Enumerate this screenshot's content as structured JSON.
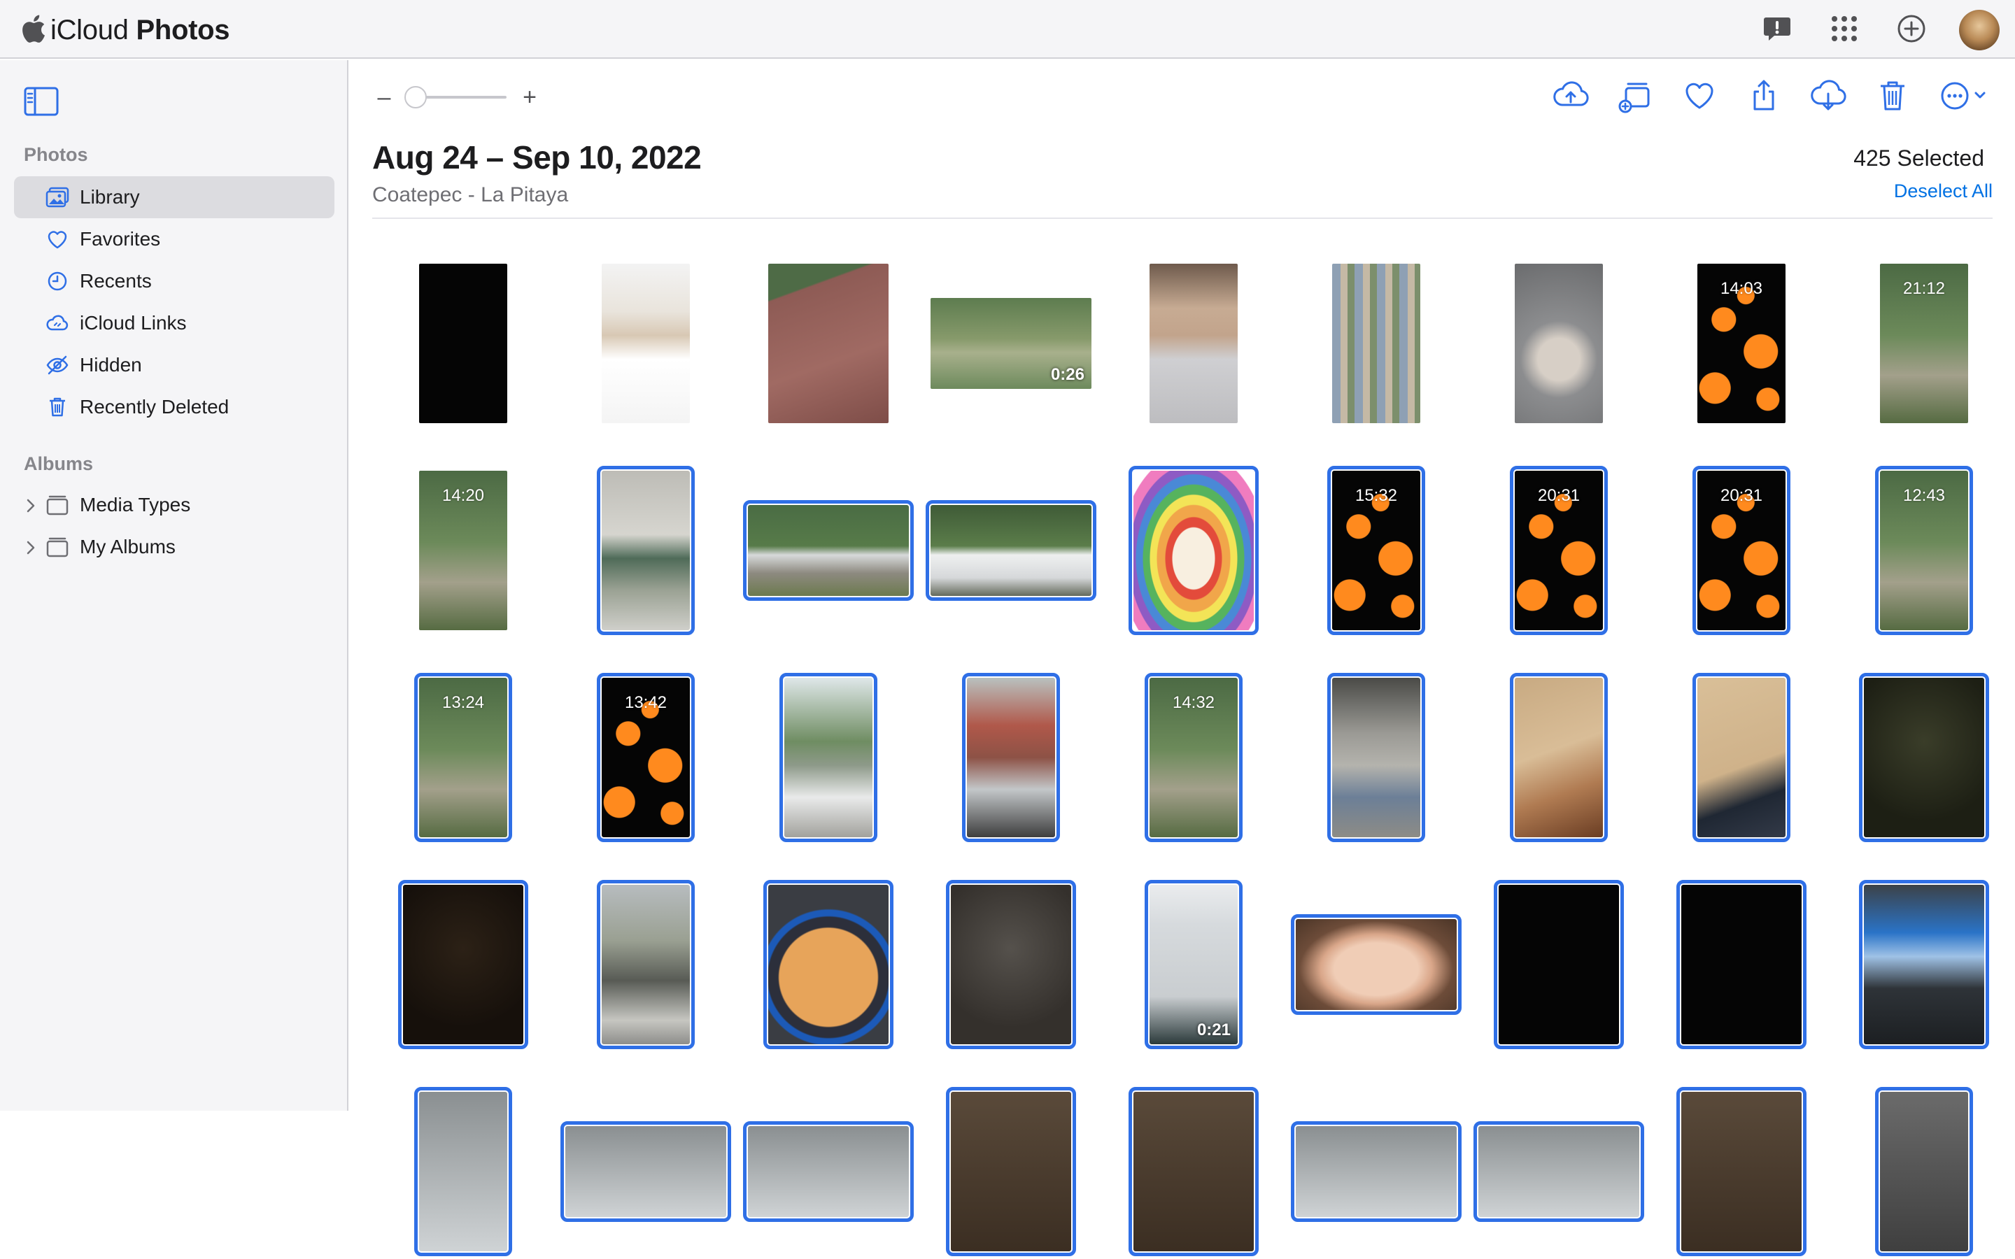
{
  "app": {
    "brand_light": "iCloud",
    "brand_bold": "Photos",
    "top_icons": [
      "feedback-icon",
      "app-grid-icon",
      "add-circle-icon"
    ],
    "accent_color": "#2f6fe6"
  },
  "sidebar": {
    "sections": [
      {
        "title": "Photos"
      },
      {
        "title": "Albums"
      }
    ],
    "items": [
      {
        "label": "Library",
        "icon": "library-icon",
        "active": true
      },
      {
        "label": "Favorites",
        "icon": "heart-icon"
      },
      {
        "label": "Recents",
        "icon": "clock-icon"
      },
      {
        "label": "iCloud Links",
        "icon": "link-cloud-icon"
      },
      {
        "label": "Hidden",
        "icon": "eye-slash-icon"
      },
      {
        "label": "Recently Deleted",
        "icon": "trash-icon"
      },
      {
        "label": "Media Types",
        "icon": "folder-icon",
        "expandable": true
      },
      {
        "label": "My Albums",
        "icon": "folder-icon",
        "expandable": true
      }
    ]
  },
  "toolbar": {
    "zoom_minus": "–",
    "zoom_plus": "+",
    "buttons": [
      "upload-icon",
      "add-to-album-icon",
      "favorite-icon",
      "share-icon",
      "download-icon",
      "delete-icon",
      "more-icon"
    ]
  },
  "header": {
    "date_range": "Aug 24 – Sep 10, 2022",
    "location": "Coatepec - La Pitaya",
    "selected_count": "425 Selected",
    "deselect_label": "Deselect All"
  },
  "grid": {
    "rows": [
      [
        {
          "kind": "black",
          "orient": "tall",
          "selected": false
        },
        {
          "kind": "phonescreen",
          "orient": "tall",
          "selected": false
        },
        {
          "kind": "roof",
          "orient": "tallwide",
          "selected": false
        },
        {
          "kind": "bushes",
          "orient": "wide",
          "selected": false,
          "duration": "0:26"
        },
        {
          "kind": "hoodie",
          "orient": "tall",
          "selected": false
        },
        {
          "kind": "gallery",
          "orient": "tall",
          "selected": false
        },
        {
          "kind": "keyphoto",
          "orient": "tall",
          "selected": false
        },
        {
          "kind": "bokeh",
          "orient": "tall",
          "selected": false,
          "clock": "14:03"
        },
        {
          "kind": "lockscreen-forest",
          "orient": "tall",
          "selected": false,
          "clock": "21:12"
        }
      ],
      [
        {
          "kind": "lockscreen-forest",
          "orient": "tall",
          "selected": false,
          "clock": "14:20"
        },
        {
          "kind": "carseat",
          "orient": "tall",
          "selected": true
        },
        {
          "kind": "parking",
          "orient": "wide",
          "selected": true
        },
        {
          "kind": "whitecar",
          "orient": "wide",
          "selected": true
        },
        {
          "kind": "mushroom",
          "orient": "tallwide",
          "selected": true
        },
        {
          "kind": "bokeh",
          "orient": "tall",
          "selected": true,
          "clock": "15:32"
        },
        {
          "kind": "bokeh",
          "orient": "tall",
          "selected": true,
          "clock": "20:31"
        },
        {
          "kind": "bokeh",
          "orient": "tall",
          "selected": true,
          "clock": "20:31"
        },
        {
          "kind": "lockscreen-forest",
          "orient": "tall",
          "selected": true,
          "clock": "12:43"
        }
      ],
      [
        {
          "kind": "lockscreen-forest",
          "orient": "tall",
          "selected": true,
          "clock": "13:24"
        },
        {
          "kind": "bokeh",
          "orient": "tall",
          "selected": true,
          "clock": "13:42"
        },
        {
          "kind": "tower",
          "orient": "tall",
          "selected": true
        },
        {
          "kind": "redbuilding",
          "orient": "tall",
          "selected": true
        },
        {
          "kind": "lockscreen-forest",
          "orient": "tall",
          "selected": true,
          "clock": "14:32"
        },
        {
          "kind": "backseat",
          "orient": "tall",
          "selected": true
        },
        {
          "kind": "woodlock",
          "orient": "tall",
          "selected": true
        },
        {
          "kind": "woodlock2",
          "orient": "tall",
          "selected": true
        },
        {
          "kind": "darkolive",
          "orient": "tallwide",
          "selected": true
        }
      ],
      [
        {
          "kind": "darkbrown",
          "orient": "tallwide",
          "selected": true
        },
        {
          "kind": "carwindow",
          "orient": "tall",
          "selected": true
        },
        {
          "kind": "pan",
          "orient": "tallwide",
          "selected": true
        },
        {
          "kind": "darkgray",
          "orient": "tallwide",
          "selected": true
        },
        {
          "kind": "keypad",
          "orient": "tall",
          "selected": true,
          "duration": "0:21"
        },
        {
          "kind": "face",
          "orient": "wide",
          "selected": true
        },
        {
          "kind": "black",
          "orient": "tallwide",
          "selected": true
        },
        {
          "kind": "black",
          "orient": "tallwide",
          "selected": true
        },
        {
          "kind": "monitor",
          "orient": "tallwide",
          "selected": true
        }
      ],
      [
        {
          "kind": "partial3",
          "orient": "tall",
          "selected": true
        },
        {
          "kind": "partial3",
          "orient": "wide",
          "selected": true
        },
        {
          "kind": "partial3",
          "orient": "wide",
          "selected": true
        },
        {
          "kind": "partial2",
          "orient": "tallwide",
          "selected": true
        },
        {
          "kind": "partial2",
          "orient": "tallwide",
          "selected": true
        },
        {
          "kind": "partial3",
          "orient": "wide",
          "selected": true
        },
        {
          "kind": "partial3",
          "orient": "wide",
          "selected": true
        },
        {
          "kind": "partial2",
          "orient": "tallwide",
          "selected": true
        },
        {
          "kind": "partial",
          "orient": "tall",
          "selected": true
        }
      ]
    ]
  }
}
